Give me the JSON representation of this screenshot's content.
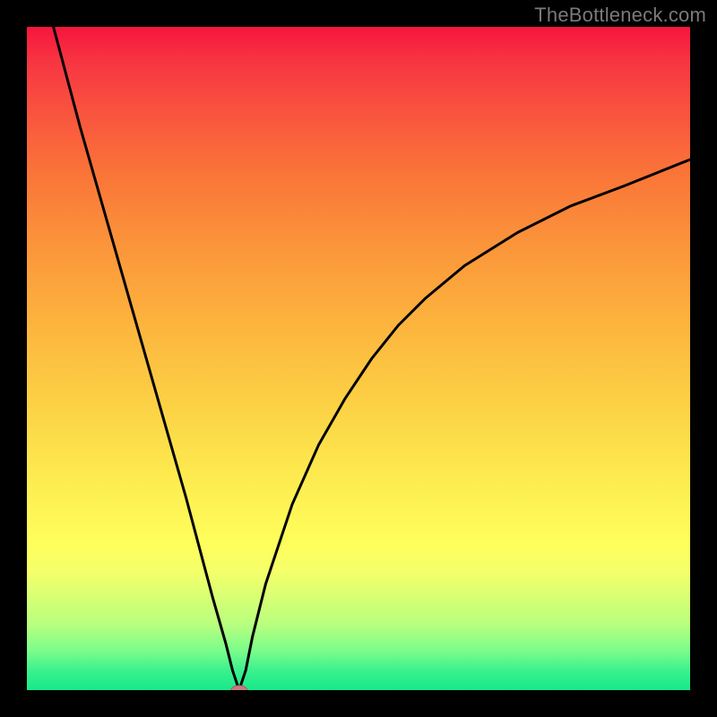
{
  "watermark": "TheBottleneck.com",
  "colors": {
    "frame": "#000000",
    "curve": "#000000",
    "marker": "#c97a82"
  },
  "chart_data": {
    "type": "line",
    "title": "",
    "xlabel": "",
    "ylabel": "",
    "xlim": [
      0,
      100
    ],
    "ylim": [
      0,
      100
    ],
    "note": "Axes are unlabeled; values below are estimated relative percentages read from pixel positions. The curve is V-shaped: a steep linear descent from the top-left to a minimum near x≈32, then a concave rise that asymptotes toward ~80% at the right edge.",
    "series": [
      {
        "name": "bottleneck-curve",
        "x": [
          4,
          8,
          12,
          16,
          20,
          24,
          28,
          30,
          31,
          32,
          33,
          34,
          36,
          38,
          40,
          44,
          48,
          52,
          56,
          60,
          66,
          74,
          82,
          90,
          100
        ],
        "y": [
          100,
          85,
          71,
          57,
          43,
          29,
          14,
          7,
          3,
          0,
          3,
          8,
          16,
          22,
          28,
          37,
          44,
          50,
          55,
          59,
          64,
          69,
          73,
          76,
          80
        ]
      }
    ],
    "marker": {
      "x": 32,
      "y": 0,
      "rx": 1.2,
      "ry": 0.7
    },
    "background_gradient_stops": [
      {
        "pos": 0,
        "color": "#f6153d"
      },
      {
        "pos": 12,
        "color": "#f9503f"
      },
      {
        "pos": 32,
        "color": "#fb923a"
      },
      {
        "pos": 56,
        "color": "#fccf44"
      },
      {
        "pos": 78,
        "color": "#feff5c"
      },
      {
        "pos": 90,
        "color": "#b9ff7e"
      },
      {
        "pos": 100,
        "color": "#16e98a"
      }
    ]
  }
}
